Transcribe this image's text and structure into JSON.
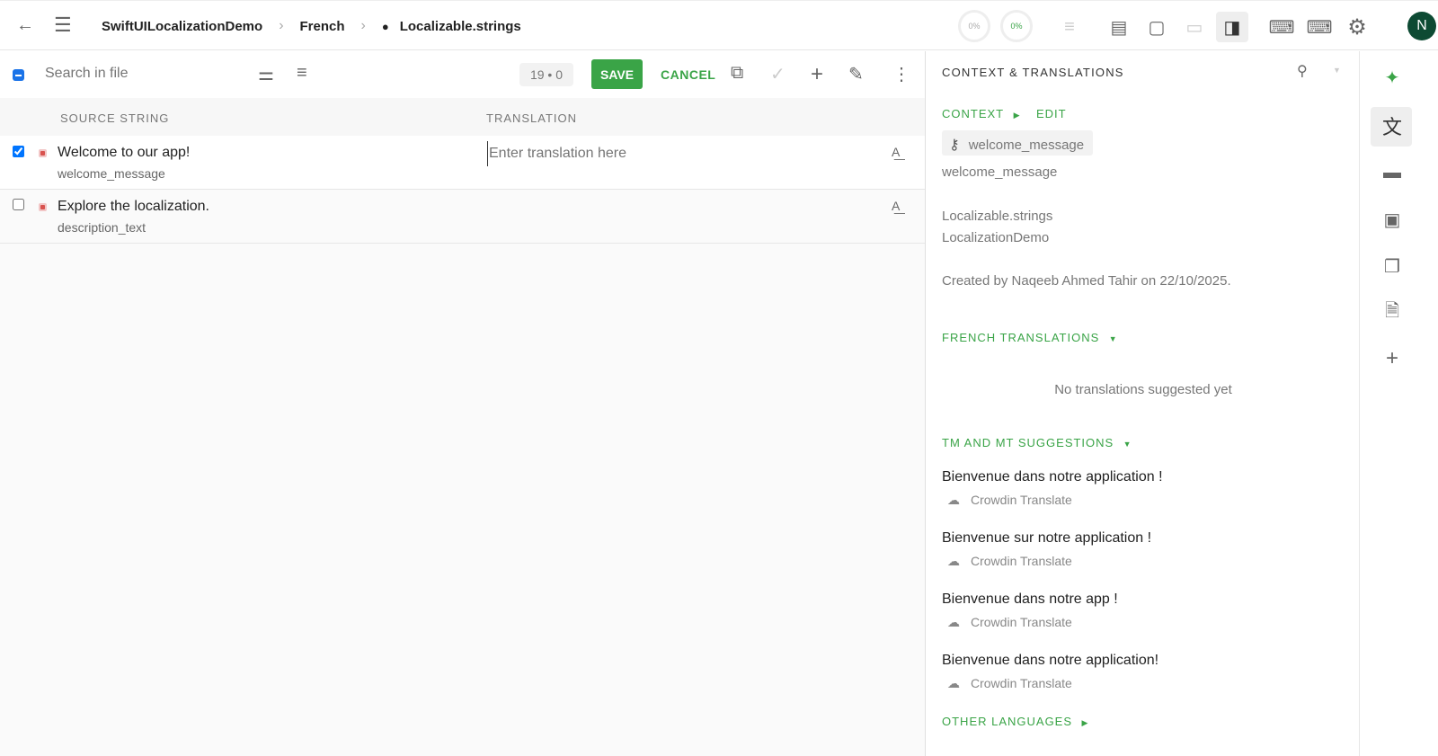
{
  "header": {
    "breadcrumb": [
      "SwiftUILocalizationDemo",
      "French",
      "Localizable.strings"
    ],
    "progress": [
      "0%",
      "0%"
    ],
    "avatar": "N",
    "accent": "#3aa447"
  },
  "toolbar": {
    "search_placeholder": "Search in file",
    "counter": "19 • 0",
    "save": "SAVE",
    "cancel": "CANCEL"
  },
  "table": {
    "headers": [
      "SOURCE STRING",
      "TRANSLATION"
    ],
    "translation_placeholder": "Enter translation here",
    "rows": [
      {
        "source": "Welcome to our app!",
        "key": "welcome_message",
        "checked": true
      },
      {
        "source": "Explore the localization.",
        "key": "description_text",
        "checked": false
      }
    ]
  },
  "panel": {
    "title": "CONTEXT & TRANSLATIONS",
    "context": "CONTEXT",
    "edit": "EDIT",
    "key_chip": "welcome_message",
    "key": "welcome_message",
    "file": "Localizable.strings",
    "project": "LocalizationDemo",
    "created": "Created by Naqeeb Ahmed Tahir on 22/10/2025.",
    "french": "FRENCH TRANSLATIONS",
    "none": "No translations suggested yet",
    "tm": "TM AND MT SUGGESTIONS",
    "suggestions": [
      {
        "text": "Bienvenue dans notre application !",
        "engine": "Crowdin Translate"
      },
      {
        "text": "Bienvenue sur notre application !",
        "engine": "Crowdin Translate"
      },
      {
        "text": "Bienvenue dans notre app !",
        "engine": "Crowdin Translate"
      },
      {
        "text": "Bienvenue dans notre application!",
        "engine": "Crowdin Translate"
      }
    ],
    "other": "OTHER LANGUAGES"
  }
}
